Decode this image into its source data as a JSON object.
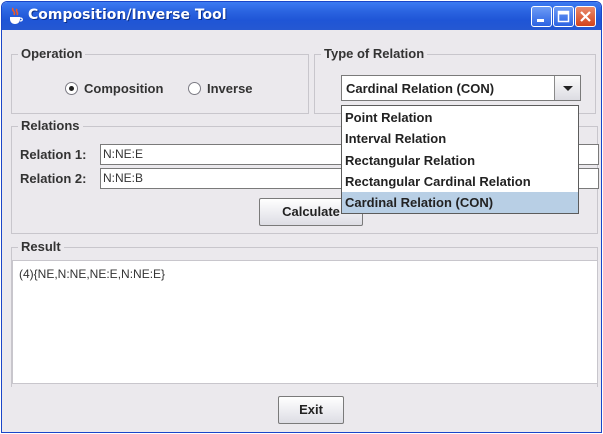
{
  "window": {
    "title": "Composition/Inverse Tool",
    "icon": "java-cup-icon",
    "controls": [
      "minimize-icon",
      "maximize-icon",
      "close-icon"
    ],
    "accent": "#2a63e0"
  },
  "operation": {
    "group_title": "Operation",
    "options": [
      {
        "label": "Composition",
        "checked": true
      },
      {
        "label": "Inverse",
        "checked": false
      }
    ]
  },
  "relation_type": {
    "group_title": "Type of Relation",
    "selected": "Cardinal Relation (CON)",
    "options": [
      "Point Relation",
      "Interval Relation",
      "Rectangular Relation",
      "Rectangular Cardinal Relation",
      "Cardinal Relation (CON)"
    ],
    "highlight_color": "#b8cfe5"
  },
  "relations": {
    "group_title": "Relations",
    "relation1_label": "Relation 1:",
    "relation1_value": "N:NE:E",
    "relation2_label": "Relation 2:",
    "relation2_value": "N:NE:B",
    "calculate_label": "Calculate"
  },
  "result": {
    "group_title": "Result",
    "text": "(4){NE,N:NE,NE:E,N:NE:E}"
  },
  "footer": {
    "exit_label": "Exit"
  }
}
